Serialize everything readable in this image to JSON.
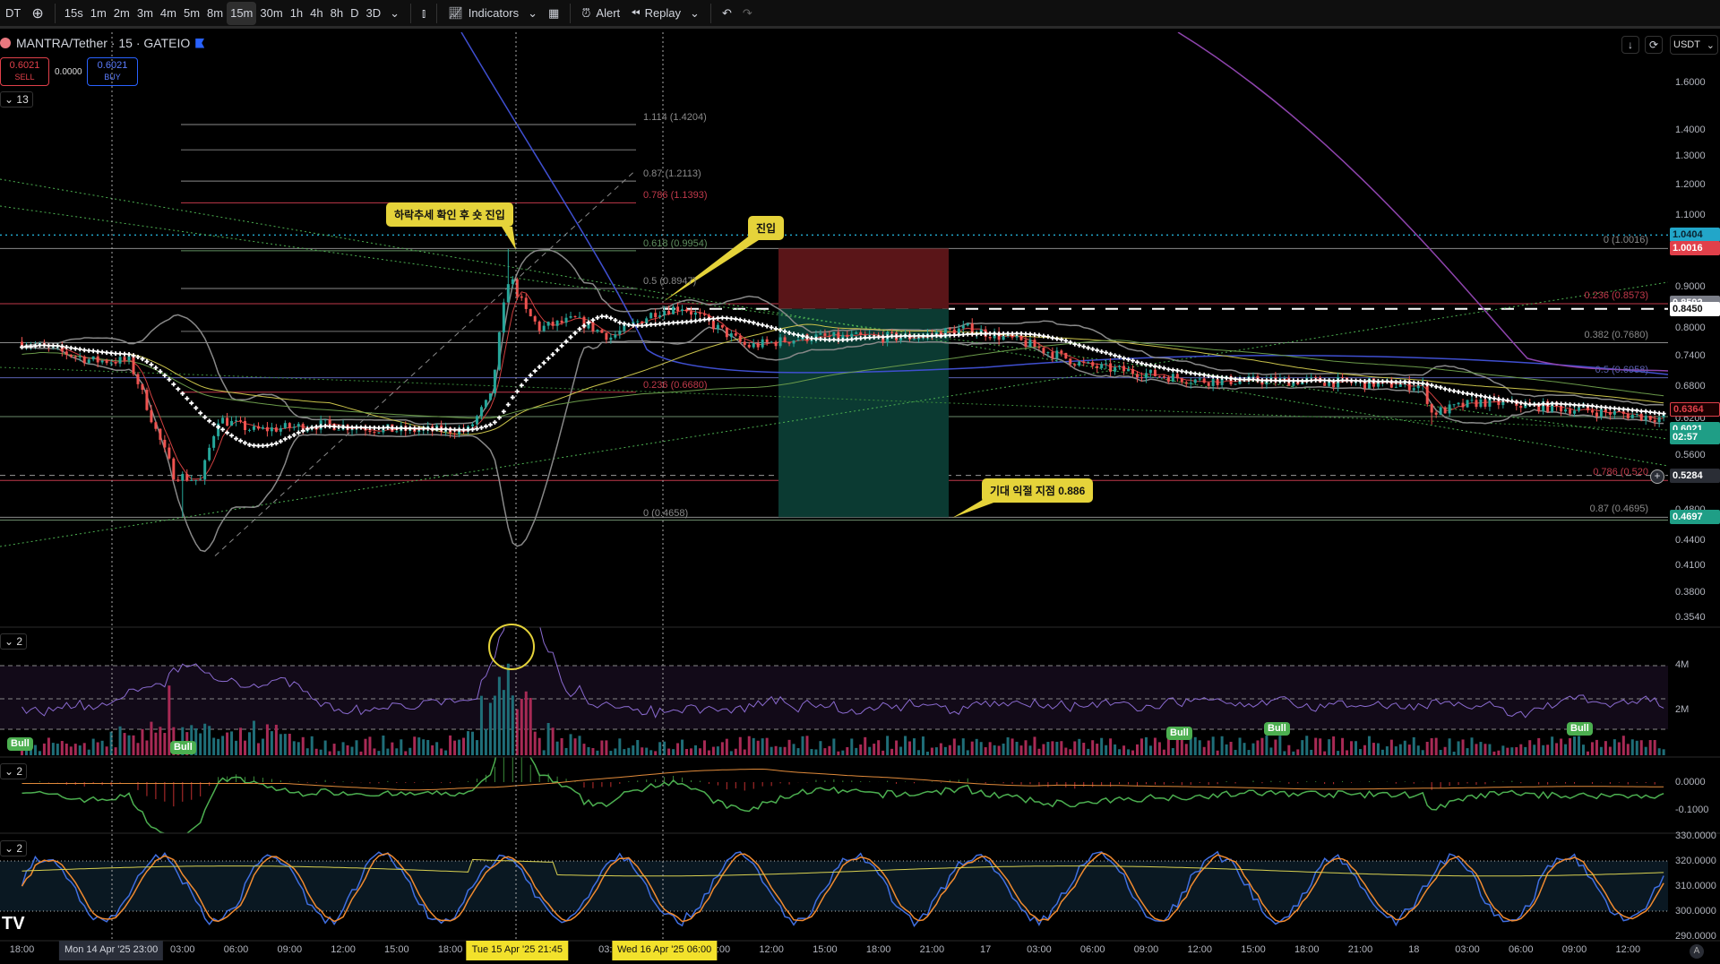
{
  "toolbar": {
    "symbol_partial": "DT",
    "intervals": [
      "15s",
      "1m",
      "2m",
      "3m",
      "4m",
      "5m",
      "8m",
      "15m",
      "30m",
      "1h",
      "4h",
      "8h",
      "D",
      "3D"
    ],
    "active_interval": "15m",
    "indicators": "Indicators",
    "alert": "Alert",
    "replay": "Replay"
  },
  "legend": {
    "title": "MANTRA/Tether · 15 · GATEIO",
    "sell_price": "0.6021",
    "sell_label": "SELL",
    "spread": "0.0000",
    "buy_price": "0.6021",
    "buy_label": "BUY"
  },
  "panes": {
    "main_count": "13",
    "volume_count": "2",
    "macd_count": "2",
    "stoch_count": "2"
  },
  "price_axis": {
    "currency": "USDT",
    "labels": [
      "1.6000",
      "1.4000",
      "1.3000",
      "1.2000",
      "1.1000",
      "0.9000",
      "0.8000",
      "0.7400",
      "0.6800",
      "0.6200",
      "0.5600",
      "0.4800",
      "0.4400",
      "0.4100",
      "0.3800",
      "0.3540"
    ]
  },
  "price_tags": [
    {
      "text": "1.0404",
      "price": 1.0404,
      "bg": "#22a6c9",
      "fg": "#0a2330"
    },
    {
      "text": "1.0016",
      "price": 1.0016,
      "bg": "#e0404a",
      "fg": "#ffffff"
    },
    {
      "text": "0.8592",
      "price": 0.8592,
      "bg": "#7b7e88",
      "fg": "#ffffff"
    },
    {
      "text": "0.8450",
      "price": 0.845,
      "bg": "#ffffff",
      "fg": "#111111"
    },
    {
      "text": "0.6364",
      "price": 0.6364,
      "bg": "#1a0000",
      "fg": "#e0404a"
    },
    {
      "text": "0.6021",
      "price": 0.6021,
      "bg": "#1f9e86",
      "fg": "#ffffff"
    },
    {
      "text": "02:57",
      "price": 0.588,
      "bg": "#1f9e86",
      "fg": "#ffffff"
    },
    {
      "text": "0.5284",
      "price": 0.5284,
      "bg": "#2a2d35",
      "fg": "#ffffff"
    },
    {
      "text": "0.4697",
      "price": 0.4697,
      "bg": "#1f9e86",
      "fg": "#ffffff"
    }
  ],
  "fib_left": [
    {
      "label": "1.114 (1.4204)",
      "price": 1.4204,
      "color": "#8a8a8a"
    },
    {
      "label": "0.87 (1.2113)",
      "price": 1.2113,
      "color": "#8a8a8a"
    },
    {
      "label": "0.786 (1.1393)",
      "price": 1.1393,
      "color": "#c0394a"
    },
    {
      "label": "0.618 (0.9954)",
      "price": 0.9954,
      "color": "#5f8f5f"
    },
    {
      "label": "0.5 (0.8947)",
      "price": 0.8947,
      "color": "#8a8a8a"
    },
    {
      "label": "0.236 (0.6680)",
      "price": 0.668,
      "color": "#c0394a"
    },
    {
      "label": "0 (0.4658)",
      "price": 0.4658,
      "color": "#8a8a8a"
    }
  ],
  "fib_right": [
    {
      "label": "0 (1.0016)",
      "price": 1.0016,
      "color": "#8a8a8a"
    },
    {
      "label": "0.236 (0.8573)",
      "price": 0.8573,
      "color": "#c0394a"
    },
    {
      "label": "0.382 (0.7680)",
      "price": 0.768,
      "color": "#8a8a8a"
    },
    {
      "label": "0.5 (0.6958)",
      "price": 0.6958,
      "color": "#5a5fb0"
    },
    {
      "label": "0.786 (0.520",
      "price": 0.521,
      "color": "#c0394a"
    },
    {
      "label": "0.87 (0.4695)",
      "price": 0.4695,
      "color": "#8a8a8a"
    }
  ],
  "annotations": {
    "short_entry": "하락추세 확인 후 숏 진입",
    "entry": "진입",
    "take_profit": "기대 익절 지점 0.886"
  },
  "volume": {
    "axis": [
      "4M",
      "2M"
    ],
    "signal_label": "Bull"
  },
  "macd": {
    "axis": [
      "0.0000",
      "-0.1000"
    ]
  },
  "stoch": {
    "axis": [
      "330.0000",
      "320.0000",
      "310.0000",
      "300.0000",
      "290.0000"
    ]
  },
  "time_axis": {
    "labels": [
      "18:00",
      "",
      "",
      "03:00",
      "06:00",
      "09:00",
      "12:00",
      "15:00",
      "18:00",
      "",
      "",
      "03:00",
      "",
      "09:00",
      "12:00",
      "15:00",
      "18:00",
      "21:00",
      "17",
      "03:00",
      "06:00",
      "09:00",
      "12:00",
      "15:00",
      "18:00",
      "21:00",
      "18",
      "03:00",
      "06:00",
      "09:00",
      "12:00"
    ],
    "highlights": [
      {
        "text": "Mon 14 Apr '25   23:00",
        "hour": 5,
        "bg": "#2a2e39",
        "fg": "#d1d4dc"
      },
      {
        "text": "Tue 15 Apr '25   21:45",
        "hour": 27.75,
        "bg": "#f2e12b",
        "fg": "#111111"
      },
      {
        "text": "Wed 16 Apr '25   06:00",
        "hour": 36,
        "bg": "#f2e12b",
        "fg": "#111111"
      }
    ],
    "auto_label": "A"
  },
  "colors": {
    "up": "#26a69a",
    "down": "#ef5350",
    "accent": "#2962ff"
  }
}
